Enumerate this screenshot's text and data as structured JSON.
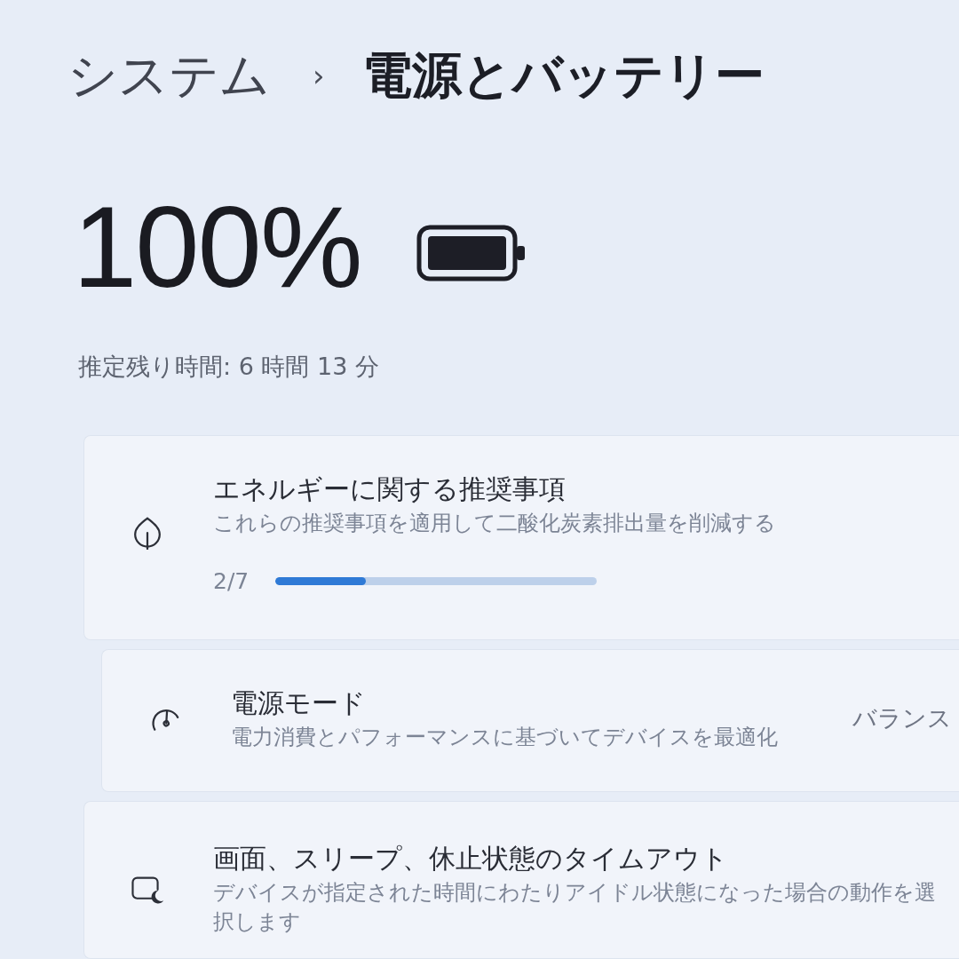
{
  "breadcrumb": {
    "parent": "システム",
    "separator": "›",
    "current": "電源とバッテリー"
  },
  "battery": {
    "percent": "100%",
    "estimate": "推定残り時間: 6 時間 13 分"
  },
  "settings": [
    {
      "kind": "progress",
      "title": "エネルギーに関する推奨事項",
      "description": "これらの推奨事項を適用して二酸化炭素排出量を削減する",
      "progress_label": "2/7",
      "level": 0.28
    },
    {
      "kind": "value",
      "title": "電源モード",
      "description": "電力消費とパフォーマンスに基づいてデバイスを最適化",
      "value": "バランス"
    },
    {
      "kind": "plain",
      "title": "画面、スリープ、休止状態のタイムアウト",
      "description": "デバイスが指定された時間にわたりアイドル状態になった場合の動作を選択します"
    }
  ]
}
